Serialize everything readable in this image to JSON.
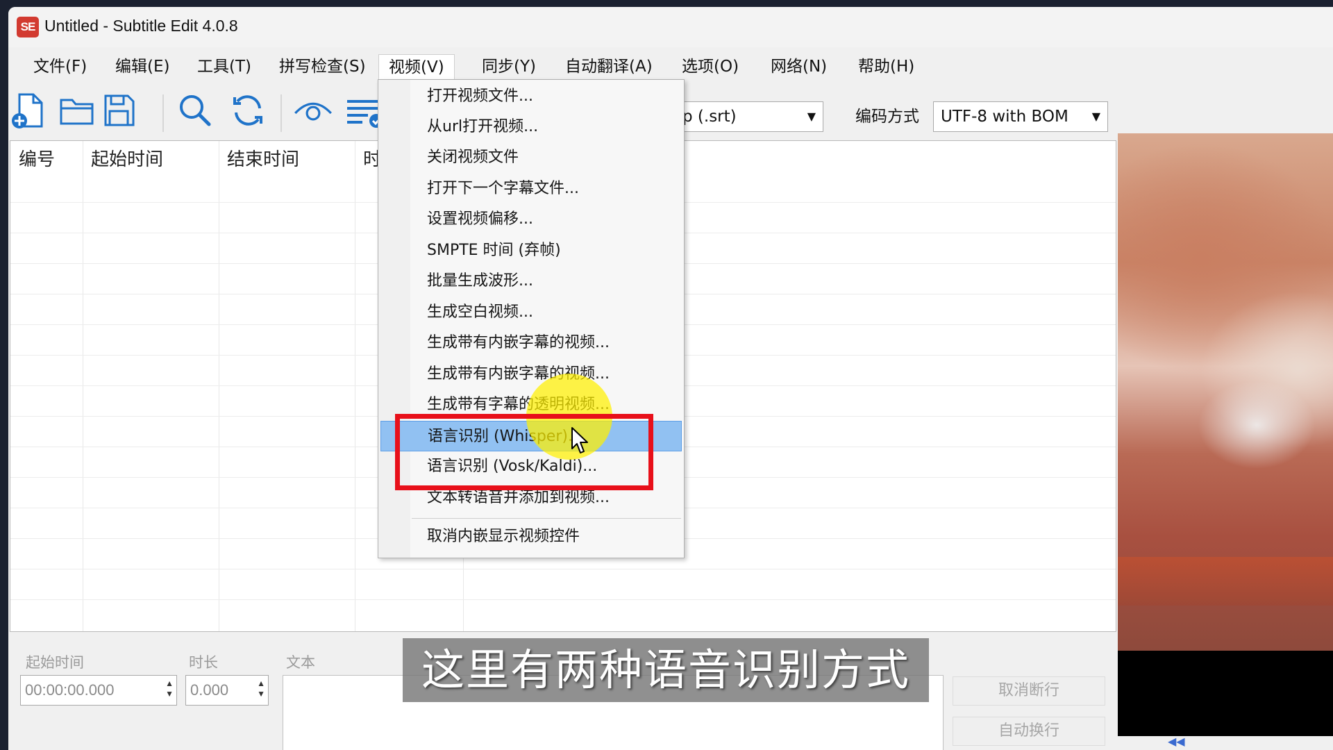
{
  "window": {
    "title": "Untitled - Subtitle Edit 4.0.8",
    "logo_text": "SE"
  },
  "menubar": {
    "items": [
      {
        "label": "文件(F)"
      },
      {
        "label": "编辑(E)"
      },
      {
        "label": "工具(T)"
      },
      {
        "label": "拼写检查(S)"
      },
      {
        "label": "视频(V)",
        "open": true
      },
      {
        "label": "同步(Y)"
      },
      {
        "label": "自动翻译(A)"
      },
      {
        "label": "选项(O)"
      },
      {
        "label": "网络(N)"
      },
      {
        "label": "帮助(H)"
      }
    ]
  },
  "toolbar": {
    "icons": [
      "new-file-icon",
      "open-folder-icon",
      "save-icon",
      "find-icon",
      "replace-icon",
      "visual-sync-icon",
      "spell-check-icon"
    ],
    "format_combo": "p (.srt)",
    "encoding_label": "编码方式",
    "encoding_value": "UTF-8 with BOM"
  },
  "grid": {
    "columns": [
      "编号",
      "起始时间",
      "结束时间",
      "时"
    ]
  },
  "video_menu": {
    "items": [
      {
        "label": "打开视频文件..."
      },
      {
        "label": "从url打开视频..."
      },
      {
        "label": "关闭视频文件"
      },
      {
        "label": "打开下一个字幕文件..."
      },
      {
        "label": "设置视频偏移..."
      },
      {
        "label": "SMPTE 时间 (弃帧)"
      },
      {
        "label": "批量生成波形..."
      },
      {
        "label": "生成空白视频..."
      },
      {
        "label": "生成带有内嵌字幕的视频..."
      },
      {
        "label": "生成带有内嵌字幕的视频..."
      },
      {
        "label": "生成带有字幕的透明视频..."
      },
      {
        "label": "语言识别 (Whisper)...",
        "highlighted": true
      },
      {
        "label": "语言识别 (Vosk/Kaldi)..."
      },
      {
        "label": "文本转语音并添加到视频..."
      },
      {
        "label": "取消内嵌显示视频控件"
      }
    ]
  },
  "edit_panel": {
    "start_label": "起始时间",
    "start_value": "00:00:00.000",
    "duration_label": "时长",
    "duration_value": "0.000",
    "text_label": "文本",
    "unbreak_button": "取消断行",
    "auto_break_button": "自动换行"
  },
  "caption": "这里有两种语音识别方式",
  "colors": {
    "highlight": "#91c1f2",
    "annotation_red": "#e8101a",
    "cursor_spot": "#fff000"
  }
}
